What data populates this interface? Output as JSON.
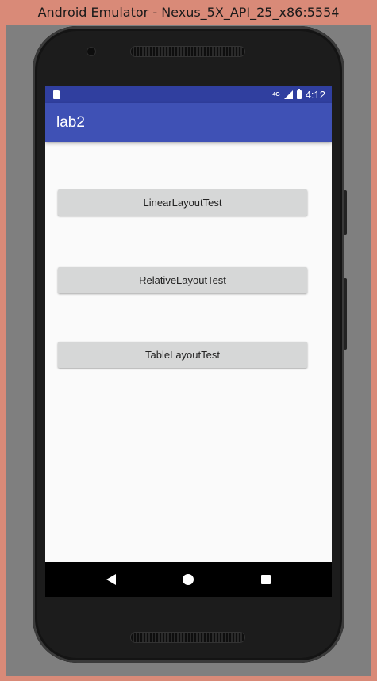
{
  "window": {
    "title": "Android Emulator - Nexus_5X_API_25_x86:5554"
  },
  "status_bar": {
    "network_label": "4G",
    "time": "4:12"
  },
  "app_bar": {
    "title": "lab2"
  },
  "buttons": [
    {
      "label": "LinearLayoutTest"
    },
    {
      "label": "RelativeLayoutTest"
    },
    {
      "label": "TableLayoutTest"
    }
  ],
  "nav_bar": {
    "items": [
      "back-icon",
      "home-icon",
      "recents-icon"
    ]
  },
  "colors": {
    "primary": "#3f51b5",
    "primary_dark": "#303f9f",
    "background": "#fafafa",
    "button": "#d6d7d7",
    "emulator_frame": "#d98a78"
  }
}
